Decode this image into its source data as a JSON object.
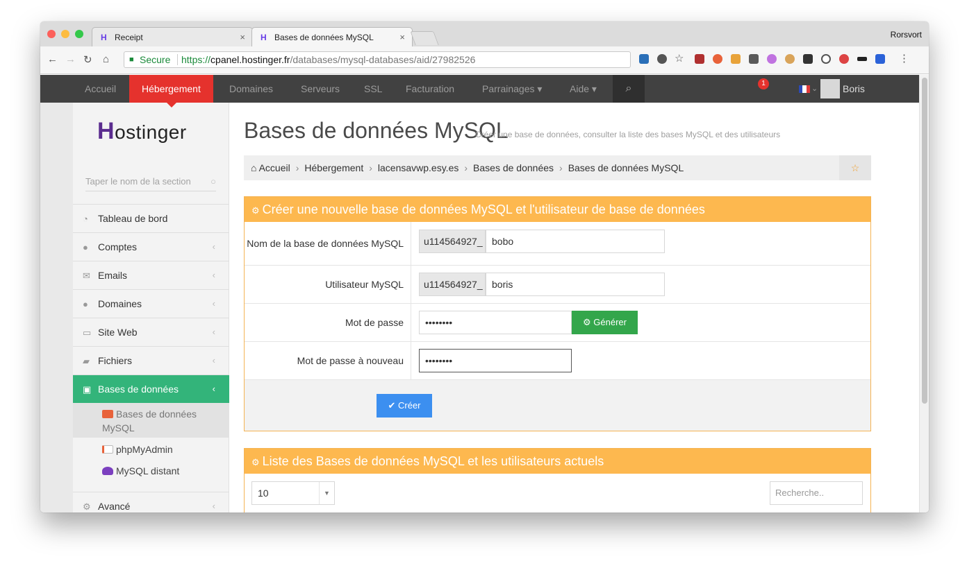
{
  "browser": {
    "tabs": [
      {
        "title": "Receipt",
        "close": "×"
      },
      {
        "title": "Bases de données MySQL",
        "close": "×"
      }
    ],
    "profile": "Rorsvort",
    "omnibox": {
      "secure": "Secure",
      "scheme": "https://",
      "host": "cpanel.hostinger.fr",
      "path": "/databases/mysql-databases/aid/27982526"
    }
  },
  "sitenav": {
    "items": [
      "Accueil",
      "Hébergement",
      "Domaines",
      "Serveurs",
      "SSL",
      "Facturation",
      "Parrainages ▾",
      "Aide ▾"
    ],
    "notifications": "1",
    "user": "Boris"
  },
  "sidebar": {
    "logo": "ostinger",
    "search_placeholder": "Taper le nom de la section",
    "items": [
      "Tableau de bord",
      "Comptes",
      "Emails",
      "Domaines",
      "Site Web",
      "Fichiers",
      "Bases de données",
      "Avancé"
    ],
    "sub_items": [
      "Bases de données MySQL",
      "phpMyAdmin",
      "MySQL distant"
    ]
  },
  "page": {
    "title": "Bases de données MySQL",
    "subtitle": "Créer une base de données, consulter la liste des bases MySQL et des utilisateurs",
    "breadcrumb": [
      "Accueil",
      "Hébergement",
      "lacensavwp.esy.es",
      "Bases de données",
      "Bases de données MySQL"
    ]
  },
  "create_panel": {
    "title": "Créer une nouvelle base de données MySQL et l'utilisateur de base de données",
    "db_label": "Nom de la base de données MySQL",
    "db_prefix": "u114564927_",
    "db_value": "bobo",
    "user_label": "Utilisateur MySQL",
    "user_prefix": "u114564927_",
    "user_value": "boris",
    "pw_label": "Mot de passe",
    "pw_value": "••••••••",
    "generate": "Générer",
    "pw2_label": "Mot de passe à nouveau",
    "pw2_value": "••••••••",
    "create": "Créer"
  },
  "list_panel": {
    "title": "Liste des Bases de données MySQL et les utilisateurs actuels",
    "page_size": "10",
    "search_placeholder": "Recherche.."
  }
}
